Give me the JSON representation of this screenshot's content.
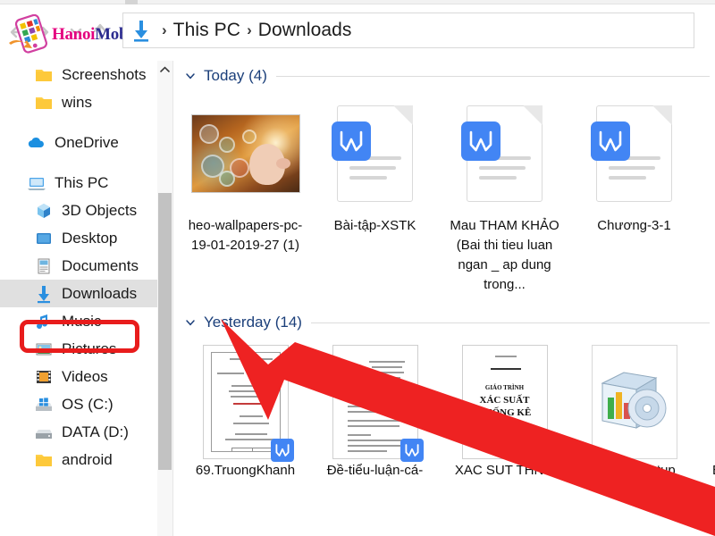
{
  "window": {
    "watermark": {
      "brand_first": "Hanoi",
      "brand_second": "Mobile"
    },
    "address_bar": {
      "download_icon": "download-arrow-icon",
      "separator": "›",
      "crumbs": [
        "This PC",
        "Downloads"
      ]
    },
    "nav_icons": [
      "back-arrow-icon",
      "forward-arrow-icon",
      "recent-locations-chevron-icon",
      "up-arrow-icon"
    ]
  },
  "sidebar": {
    "scrollbar": {
      "up_icon": "chevron-up-icon"
    },
    "items": [
      {
        "label": "Screenshots",
        "icon": "folder-icon",
        "indent": true,
        "selected": false
      },
      {
        "label": "wins",
        "icon": "folder-icon",
        "indent": true,
        "selected": false
      },
      {
        "label": "OneDrive",
        "icon": "onedrive-cloud-icon",
        "indent": false,
        "selected": false
      },
      {
        "label": "This PC",
        "icon": "this-pc-icon",
        "indent": false,
        "selected": false
      },
      {
        "label": "3D Objects",
        "icon": "3d-objects-icon",
        "indent": true,
        "selected": false
      },
      {
        "label": "Desktop",
        "icon": "desktop-icon",
        "indent": true,
        "selected": false
      },
      {
        "label": "Documents",
        "icon": "documents-icon",
        "indent": true,
        "selected": false
      },
      {
        "label": "Downloads",
        "icon": "downloads-icon",
        "indent": true,
        "selected": true
      },
      {
        "label": "Music",
        "icon": "music-note-icon",
        "indent": true,
        "selected": false
      },
      {
        "label": "Pictures",
        "icon": "pictures-icon",
        "indent": true,
        "selected": false
      },
      {
        "label": "Videos",
        "icon": "videos-icon",
        "indent": true,
        "selected": false
      },
      {
        "label": "OS (C:)",
        "icon": "windows-drive-icon",
        "indent": true,
        "selected": false
      },
      {
        "label": "DATA (D:)",
        "icon": "drive-icon",
        "indent": true,
        "selected": false
      },
      {
        "label": "android",
        "icon": "folder-icon",
        "indent": true,
        "selected": false
      }
    ]
  },
  "content": {
    "groups": [
      {
        "label": "Today (4)",
        "chevron": "chevron-down-icon",
        "items": [
          {
            "name": "heo-wallpapers-pc-19-01-2019-27 (1)",
            "kind": "image-thumbnail"
          },
          {
            "name": "Bài-tập-XSTK",
            "kind": "word-document"
          },
          {
            "name": "Mau THAM KHẢO (Bai thi tieu luan ngan _ ap dung trong...",
            "kind": "word-document"
          },
          {
            "name": "Chương-3-1",
            "kind": "word-document"
          }
        ]
      },
      {
        "label": "Yesterday (14)",
        "chevron": "chevron-down-icon",
        "items": [
          {
            "name": "69.TruongKhanh",
            "kind": "word-document-preview"
          },
          {
            "name": "Đề-tiểu-luận-cá-",
            "kind": "word-document-preview"
          },
          {
            "name": "XAC SUT THNG",
            "kind": "book-cover-preview",
            "cover_lines": [
              "GIÁO TRÌNH",
              "XÁC SUẤT",
              "THỐNG KÊ"
            ]
          },
          {
            "name": "ChromeSetup",
            "kind": "installer-icon"
          },
          {
            "name": "B",
            "kind": "clipped-item"
          }
        ]
      }
    ]
  },
  "annotations": {
    "highlight_box": {
      "target": "Downloads",
      "color": "#e81c1c"
    },
    "arrow": {
      "color": "#ee2222",
      "points_to": "Downloads"
    }
  },
  "colors": {
    "accent_blue": "#4285f4",
    "highlight_red": "#e81c1c",
    "group_header_text": "#1b3f7a",
    "selected_row": "#e0e0e0"
  }
}
